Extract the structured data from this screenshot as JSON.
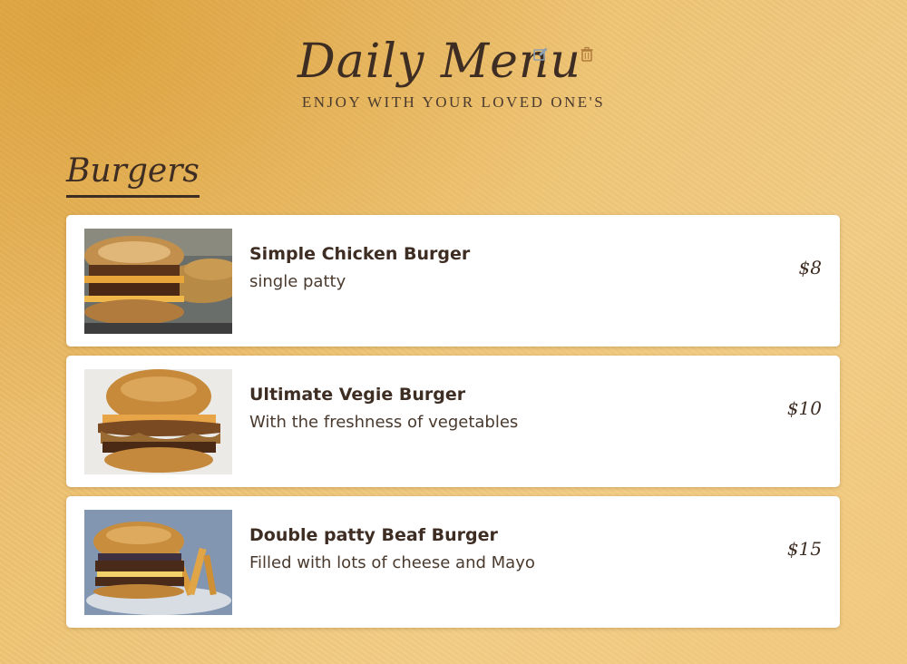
{
  "header": {
    "title": "Daily Menu",
    "subtitle": "ENJOY WITH YOUR LOVED ONE'S",
    "edit_icon": "edit-icon",
    "delete_icon": "trash-icon"
  },
  "section": {
    "title": "Burgers"
  },
  "items": [
    {
      "name": "Simple Chicken Burger",
      "description": "single patty",
      "price": "$8",
      "image": "burger-photo"
    },
    {
      "name": "Ultimate Vegie Burger",
      "description": "With the freshness of vegetables",
      "price": "$10",
      "image": "burger-photo"
    },
    {
      "name": "Double patty Beaf Burger",
      "description": "Filled with lots of cheese and Mayo",
      "price": "$15",
      "image": "burger-photo"
    }
  ],
  "colors": {
    "text_dark": "#3e2d23",
    "background": "#efc474",
    "card": "#ffffff",
    "edit_icon": "#8a9fb0",
    "delete_icon": "#b07a3a"
  }
}
